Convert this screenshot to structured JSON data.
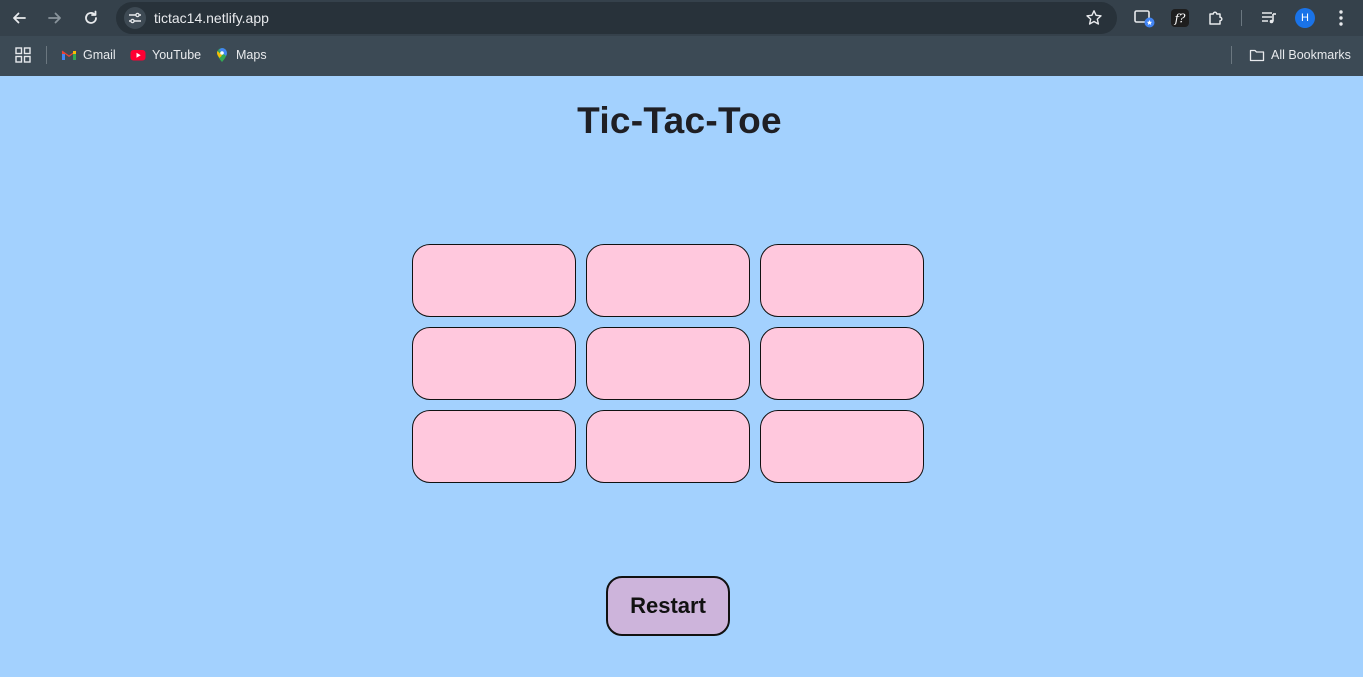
{
  "browser": {
    "url": "tictac14.netlify.app",
    "profile_initial": "H",
    "bookmarks": [
      {
        "label": "Gmail",
        "icon": "gmail-icon"
      },
      {
        "label": "YouTube",
        "icon": "youtube-icon"
      },
      {
        "label": "Maps",
        "icon": "maps-icon"
      }
    ],
    "all_bookmarks_label": "All Bookmarks"
  },
  "page": {
    "title": "Tic-Tac-Toe",
    "board": {
      "cells": [
        "",
        "",
        "",
        "",
        "",
        "",
        "",
        "",
        ""
      ]
    },
    "restart_label": "Restart"
  },
  "colors": {
    "background": "#a3d1fe",
    "cell": "#ffc8dd",
    "restart": "#cdb4db",
    "title": "#1f1f24"
  }
}
